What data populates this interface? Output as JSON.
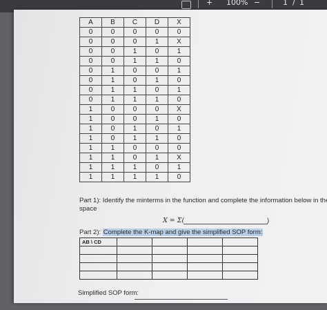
{
  "toolbar": {
    "zoom": "100%",
    "page_current": "1",
    "page_separator": "/",
    "page_total": "1",
    "plus": "+",
    "minus": "−"
  },
  "truth_table": {
    "headers": [
      "A",
      "B",
      "C",
      "D",
      "X"
    ],
    "rows": [
      [
        "0",
        "0",
        "0",
        "0",
        "0"
      ],
      [
        "0",
        "0",
        "0",
        "1",
        "X"
      ],
      [
        "0",
        "0",
        "1",
        "0",
        "1"
      ],
      [
        "0",
        "0",
        "1",
        "1",
        "0"
      ],
      [
        "0",
        "1",
        "0",
        "0",
        "1"
      ],
      [
        "0",
        "1",
        "0",
        "1",
        "0"
      ],
      [
        "0",
        "1",
        "1",
        "0",
        "1"
      ],
      [
        "0",
        "1",
        "1",
        "1",
        "0"
      ],
      [
        "1",
        "0",
        "0",
        "0",
        "X"
      ],
      [
        "1",
        "0",
        "0",
        "1",
        "0"
      ],
      [
        "1",
        "0",
        "1",
        "0",
        "1"
      ],
      [
        "1",
        "0",
        "1",
        "1",
        "0"
      ],
      [
        "1",
        "1",
        "0",
        "0",
        "0"
      ],
      [
        "1",
        "1",
        "0",
        "1",
        "X"
      ],
      [
        "1",
        "1",
        "1",
        "0",
        "1"
      ],
      [
        "1",
        "1",
        "1",
        "1",
        "0"
      ]
    ]
  },
  "part1": {
    "line1": "Part 1): Identify the minterms in the function and complete the information below in the",
    "line2": "space",
    "formula": "X = Σ(",
    "close_paren": ")"
  },
  "part2": {
    "prefix": "Part 2):",
    "highlighted": "Complete the K-map and give the simplified SOP form:"
  },
  "kmap": {
    "corner": "AB  \\ CD",
    "rows": 4,
    "cols": 4
  },
  "sop": {
    "label": "Simplified SOP form:"
  }
}
